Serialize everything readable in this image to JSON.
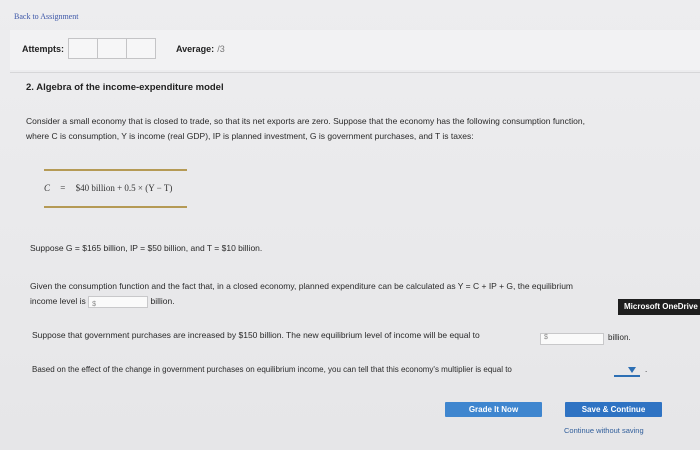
{
  "nav": {
    "back_label": "Back to Assignment"
  },
  "header": {
    "attempts_label": "Attempts:",
    "average_label": "Average:",
    "average_value": "/3"
  },
  "question": {
    "title": "2. Algebra of the income-expenditure model",
    "intro_line1": "Consider a small economy that is closed to trade, so that its net exports are zero. Suppose that the economy has the following consumption function,",
    "intro_line2": "where C is consumption, Y is income (real GDP), IP is planned investment, G is government purchases, and T is taxes:",
    "equation_lhs": "C",
    "equation_eq": "=",
    "equation_rhs": "$40 billion + 0.5 × (Y − T)",
    "suppose_values": "Suppose G = $165 billion, IP = $50 billion, and T = $10 billion.",
    "given_line1": "Given the consumption function and the fact that, in a closed economy, planned expenditure can be calculated as Y = C + IP + G, the equilibrium",
    "given_line2_prefix": "income level is",
    "given_line2_suffix": "billion.",
    "input_currency": "$",
    "gov_increase_text": "Suppose that government purchases are increased by $150 billion. The new equilibrium level of income will be equal to",
    "gov_increase_suffix": "billion.",
    "multiplier_text": "Based on the effect of the change in government purchases on equilibrium income, you can tell that this economy's multiplier is equal to",
    "multiplier_period": "."
  },
  "overlay": {
    "onedrive_label": "Microsoft OneDrive"
  },
  "actions": {
    "grade_label": "Grade It Now",
    "save_label": "Save & Continue",
    "continue_label": "Continue without saving"
  }
}
